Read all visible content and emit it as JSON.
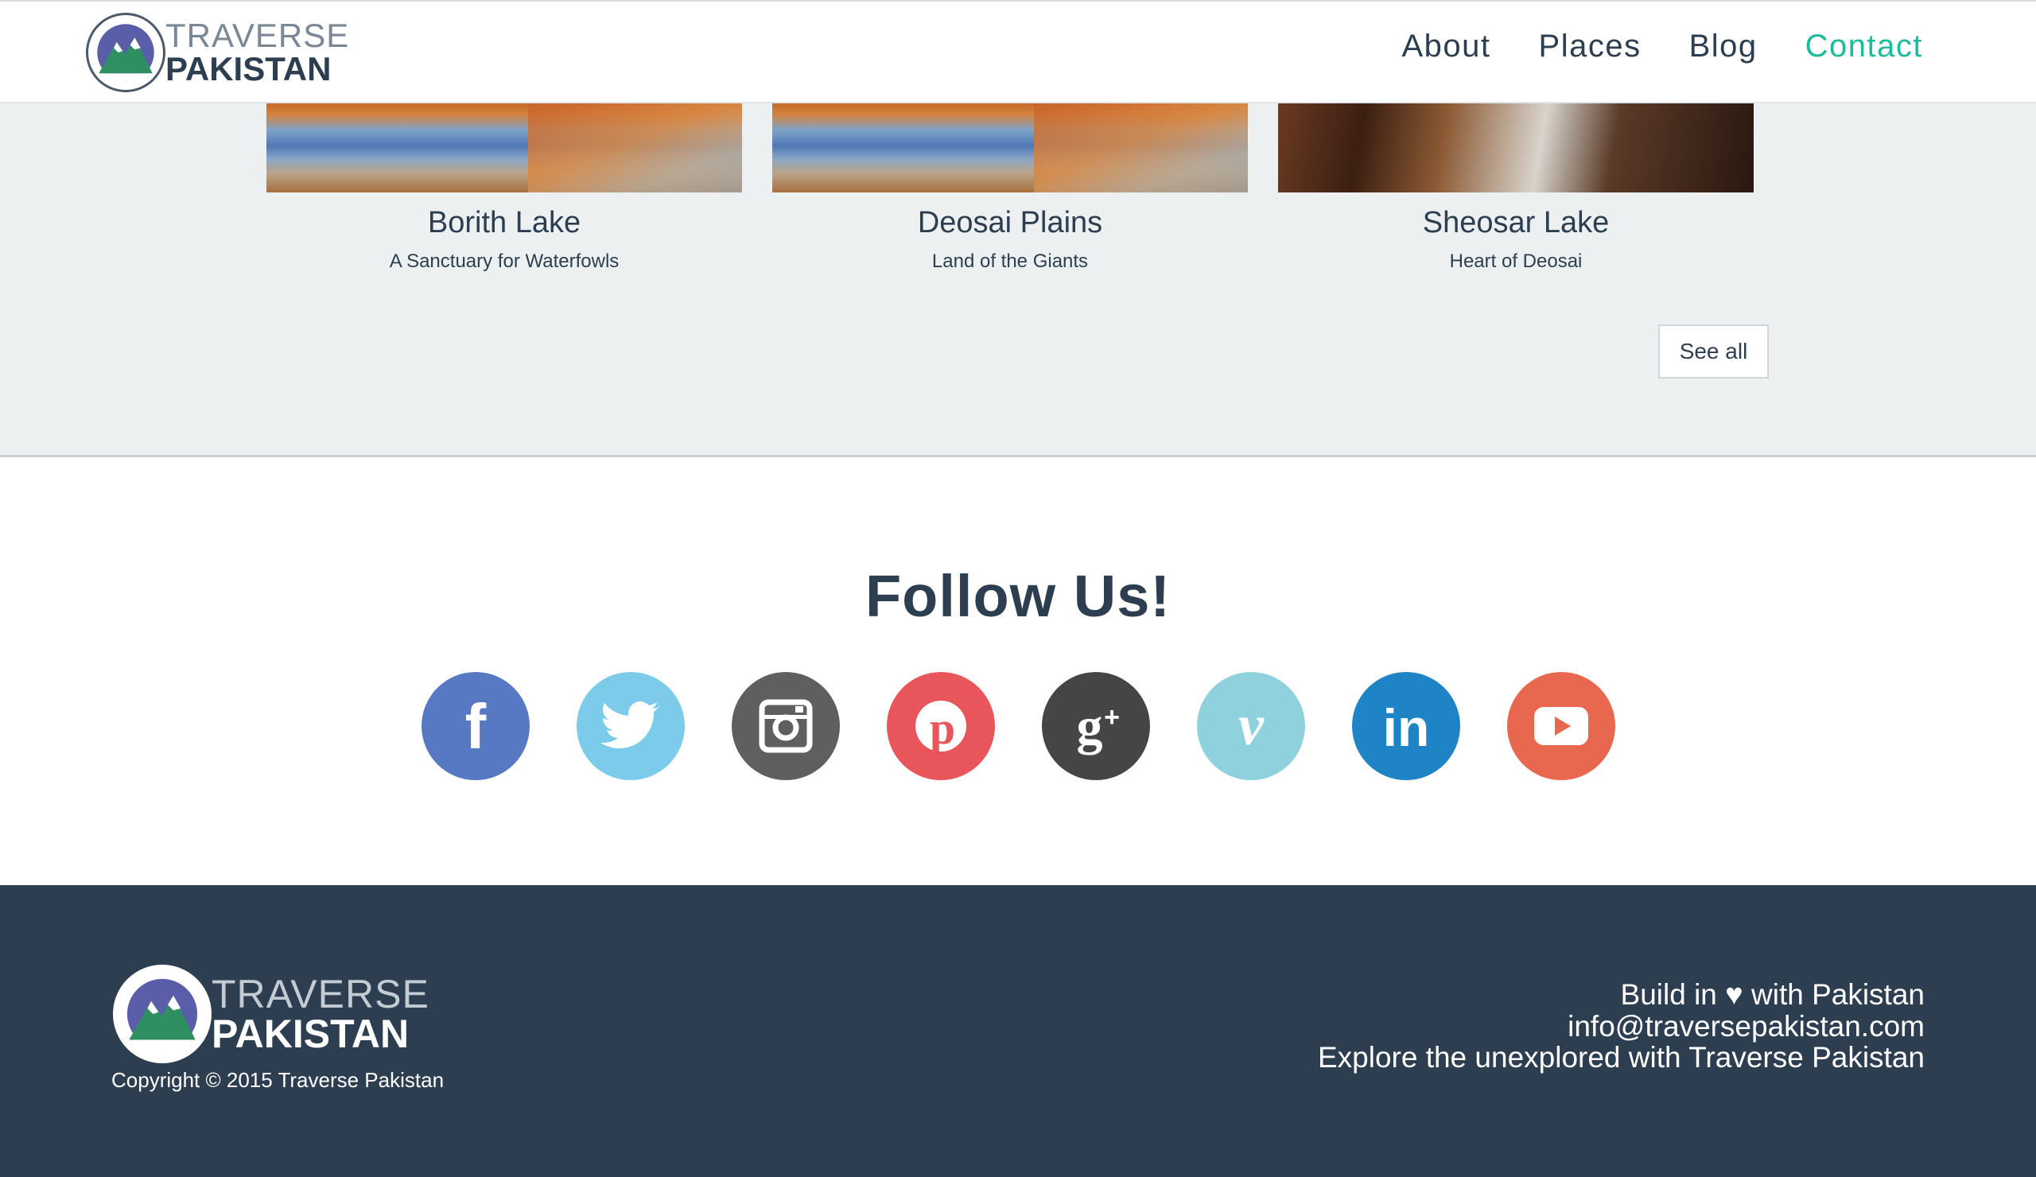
{
  "header": {
    "logo": {
      "top": "TRAVERSE",
      "bottom": "PAKISTAN"
    },
    "nav": [
      {
        "label": "About"
      },
      {
        "label": "Places"
      },
      {
        "label": "Blog"
      },
      {
        "label": "Contact",
        "active": true
      }
    ]
  },
  "places": {
    "cards": [
      {
        "title": "Borith Lake",
        "subtitle": "A Sanctuary for Waterfowls"
      },
      {
        "title": "Deosai Plains",
        "subtitle": "Land of the Giants"
      },
      {
        "title": "Sheosar Lake",
        "subtitle": "Heart of Deosai"
      }
    ],
    "see_all_label": "See all"
  },
  "follow": {
    "title": "Follow Us!",
    "socials": [
      {
        "name": "facebook",
        "glyph": "f",
        "color": "#5778c2"
      },
      {
        "name": "twitter",
        "glyph": "🐦",
        "color": "#7ccbeb"
      },
      {
        "name": "instagram",
        "glyph": "◻",
        "color": "#5f5f5f"
      },
      {
        "name": "pinterest",
        "glyph": "P",
        "color": "#e8565c"
      },
      {
        "name": "google-plus",
        "glyph": "g+",
        "color": "#454545"
      },
      {
        "name": "vimeo",
        "glyph": "v",
        "color": "#8fd1dc"
      },
      {
        "name": "linkedin",
        "glyph": "in",
        "color": "#1f84c6"
      },
      {
        "name": "youtube",
        "glyph": "▶",
        "color": "#e8684f"
      }
    ]
  },
  "footer": {
    "logo": {
      "top": "TRAVERSE",
      "bottom": "PAKISTAN"
    },
    "copyright": "Copyright © 2015 Traverse Pakistan",
    "build_prefix": "Build in",
    "build_suffix": "with Pakistan",
    "email": "info@traversepakistan.com",
    "tagline": "Explore the unexplored with Traverse Pakistan"
  },
  "colors": {
    "accent": "#1abc9c",
    "text_dark": "#2c3e50",
    "section_bg": "#ecf0f1",
    "footer_bg": "#2c3e50"
  }
}
